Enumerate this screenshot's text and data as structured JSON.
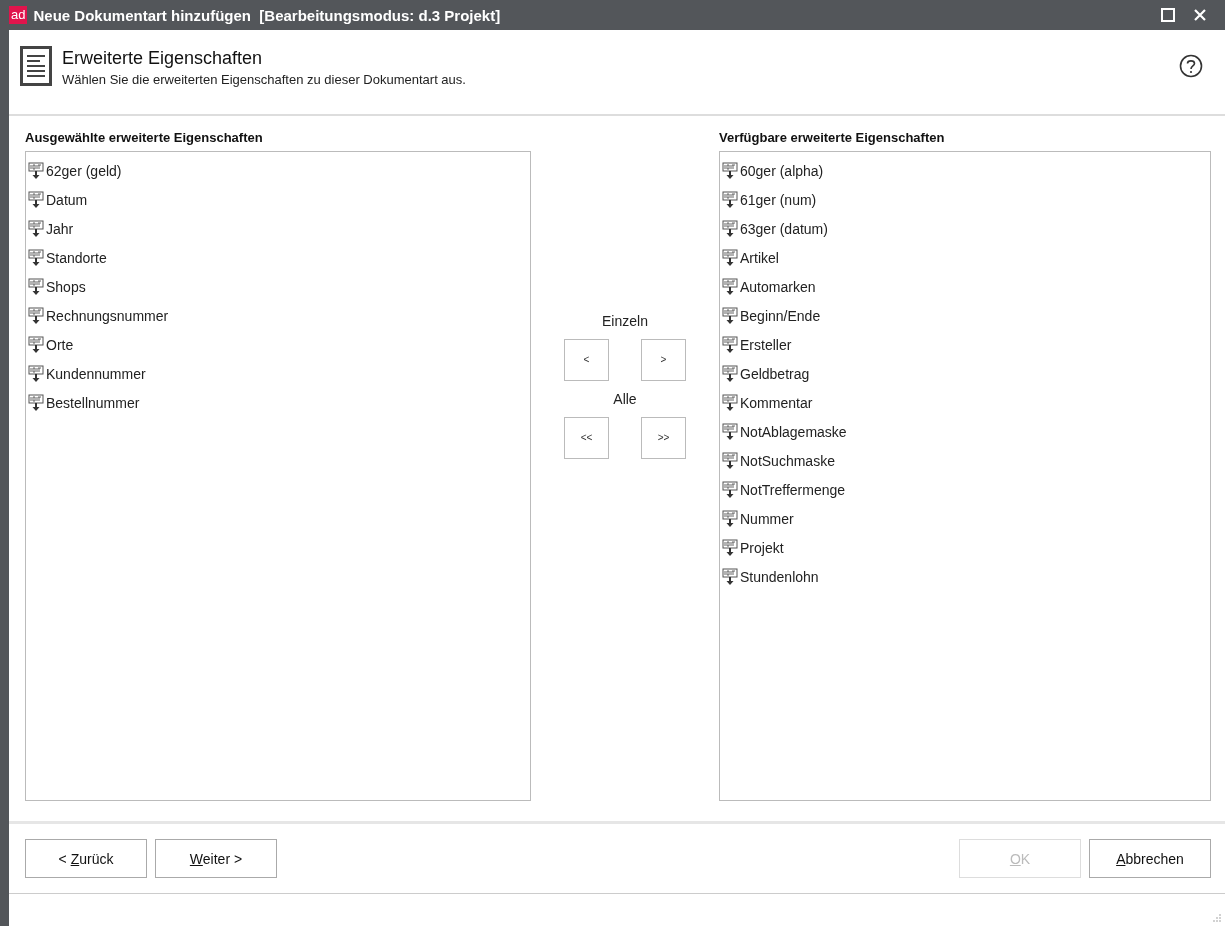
{
  "window": {
    "logo": "ad",
    "title": "Neue Dokumentart hinzufügen  [Bearbeitungsmodus: d.3 Projekt]"
  },
  "header": {
    "title": "Erweiterte Eigenschaften",
    "subtitle": "Wählen Sie die erweiterten Eigenschaften zu dieser Dokumentart aus."
  },
  "selected_list": {
    "title": "Ausgewählte erweiterte Eigenschaften",
    "items": [
      "62ger (geld)",
      "Datum",
      "Jahr",
      "Standorte",
      "Shops",
      "Rechnungsnummer",
      "Orte",
      "Kundennummer",
      "Bestellnummer"
    ]
  },
  "move_buttons": {
    "single_label": "Einzeln",
    "single": [
      "<",
      ">"
    ],
    "all_label": "Alle",
    "all": [
      "<<",
      ">>"
    ]
  },
  "available_list": {
    "title": "Verfügbare erweiterte Eigenschaften",
    "items": [
      "60ger (alpha)",
      "61ger (num)",
      "63ger (datum)",
      "Artikel",
      "Automarken",
      "Beginn/Ende",
      "Ersteller",
      "Geldbetrag",
      "Kommentar",
      "NotAblagemaske",
      "NotSuchmaske",
      "NotTreffermenge",
      "Nummer",
      "Projekt",
      "Stundenlohn"
    ]
  },
  "buttons_left": [
    {
      "prefix": "< ",
      "key": "Z",
      "rest": "urück",
      "disabled": false
    },
    {
      "key": "W",
      "rest": "eiter >",
      "disabled": false
    }
  ],
  "buttons_right": [
    {
      "key": "O",
      "rest": "K",
      "disabled": true
    },
    {
      "key": "A",
      "rest": "bbrechen",
      "disabled": false
    }
  ]
}
